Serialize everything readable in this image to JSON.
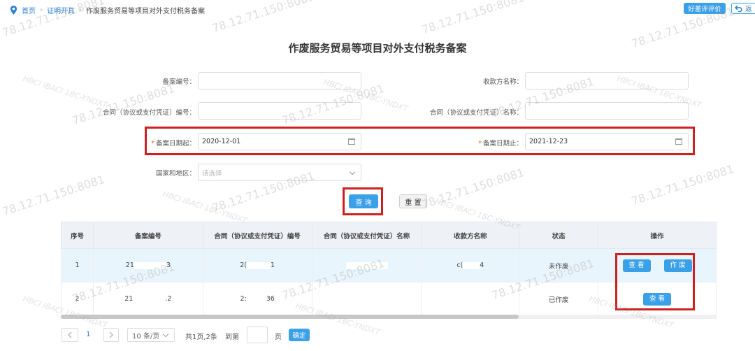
{
  "breadcrumb": {
    "home": "首页",
    "section": "证明开具",
    "current": "作废服务贸易等项目对外支付税务备案"
  },
  "top_actions": {
    "evaluate": "好差评评价",
    "back": "返"
  },
  "page_title": "作废服务贸易等项目对外支付税务备案",
  "form": {
    "record_no": {
      "label": "备案编号：",
      "value": ""
    },
    "payee_name": {
      "label": "收款方名称：",
      "value": ""
    },
    "contract_no": {
      "label": "合同（协议或支付凭证）编号：",
      "value": ""
    },
    "contract_name": {
      "label": "合同（协议或支付凭证）名称：",
      "value": ""
    },
    "date_from": {
      "required": "*",
      "label": "备案日期起：",
      "value": "2020-12-01"
    },
    "date_to": {
      "required": "*",
      "label": "备案日期止：",
      "value": "2021-12-23"
    },
    "country": {
      "label": "国家和地区：",
      "placeholder": "请选择"
    },
    "query_button": "查 询",
    "reset_button": "重 置"
  },
  "table": {
    "headers": [
      "序号",
      "备案编号",
      "合同（协议或支付凭证）编号",
      "合同（协议或支付凭证）名称",
      "收款方名称",
      "状态",
      "操作"
    ],
    "rows": [
      {
        "index": "1",
        "record_a": "21",
        "record_b": "3",
        "contract_a": "2(",
        "contract_b": "1",
        "name": "",
        "payee_a": "c(",
        "payee_b": "4",
        "status": "未作废",
        "view": "查 看",
        "void": "作 废"
      },
      {
        "index": "2",
        "record_a": "21",
        "record_b": ".2",
        "contract_a": "2:",
        "contract_b": "36",
        "name": "",
        "payee_a": "",
        "payee_b": "",
        "status": "已作废",
        "view": "查 看"
      }
    ]
  },
  "pagination": {
    "current_page": "1",
    "page_size": "10 条/页",
    "summary": "共1页,2条",
    "goto_label": "到第",
    "goto_value": "",
    "page_unit": "页",
    "confirm": "确定"
  },
  "watermarks": {
    "ip": "78.12.71.150:8081",
    "code": "HBCI IBACI 1BC-YNDXT"
  },
  "colors": {
    "primary": "#3aa0e8",
    "highlight": "#cf1f1f",
    "link": "#2a7fd4"
  }
}
